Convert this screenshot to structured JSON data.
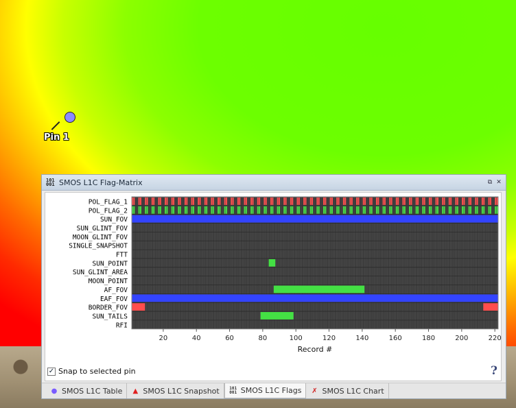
{
  "pin": {
    "label": "Pin 1"
  },
  "window": {
    "title": "SMOS L1C Flag-Matrix",
    "snap_label": "Snap to selected pin",
    "snap_checked": true,
    "help": "?"
  },
  "tabs": [
    {
      "label": "SMOS L1C Table",
      "icon": "table-icon",
      "active": false
    },
    {
      "label": "SMOS L1C Snapshot",
      "icon": "snapshot-icon",
      "active": false
    },
    {
      "label": "SMOS L1C Flags",
      "icon": "flags-icon",
      "active": true
    },
    {
      "label": "SMOS L1C Chart",
      "icon": "chart-icon",
      "active": false
    }
  ],
  "chart_data": {
    "type": "heatmap",
    "xlabel": "Record #",
    "xlim": [
      1,
      222
    ],
    "xticks": [
      20,
      40,
      60,
      80,
      100,
      120,
      140,
      160,
      180,
      200,
      220
    ],
    "rows": [
      "POL_FLAG_1",
      "POL_FLAG_2",
      "SUN_FOV",
      "SUN_GLINT_FOV",
      "MOON_GLINT_FOV",
      "SINGLE_SNAPSHOT",
      "FTT",
      "SUN_POINT",
      "SUN_GLINT_AREA",
      "MOON_POINT",
      "AF_FOV",
      "EAF_FOV",
      "BORDER_FOV",
      "SUN_TAILS",
      "RFI"
    ],
    "colors": {
      "off": "#3c3c3c",
      "red": "#ff4d4d",
      "green": "#44e044",
      "blue": "#3344ff"
    },
    "segments": [
      {
        "row": "POL_FLAG_1",
        "pattern": "alternating",
        "colors": [
          "red",
          "off"
        ]
      },
      {
        "row": "POL_FLAG_2",
        "pattern": "alternating",
        "colors": [
          "green",
          "off"
        ]
      },
      {
        "row": "SUN_FOV",
        "from": 1,
        "to": 222,
        "color": "blue"
      },
      {
        "row": "SUN_POINT",
        "from": 84,
        "to": 87,
        "color": "green"
      },
      {
        "row": "AF_FOV",
        "from": 87,
        "to": 141,
        "color": "green"
      },
      {
        "row": "EAF_FOV",
        "from": 1,
        "to": 222,
        "color": "blue"
      },
      {
        "row": "BORDER_FOV",
        "from": 1,
        "to": 8,
        "color": "red"
      },
      {
        "row": "BORDER_FOV",
        "from": 214,
        "to": 222,
        "color": "red"
      },
      {
        "row": "SUN_TAILS",
        "from": 79,
        "to": 98,
        "color": "green"
      }
    ]
  }
}
